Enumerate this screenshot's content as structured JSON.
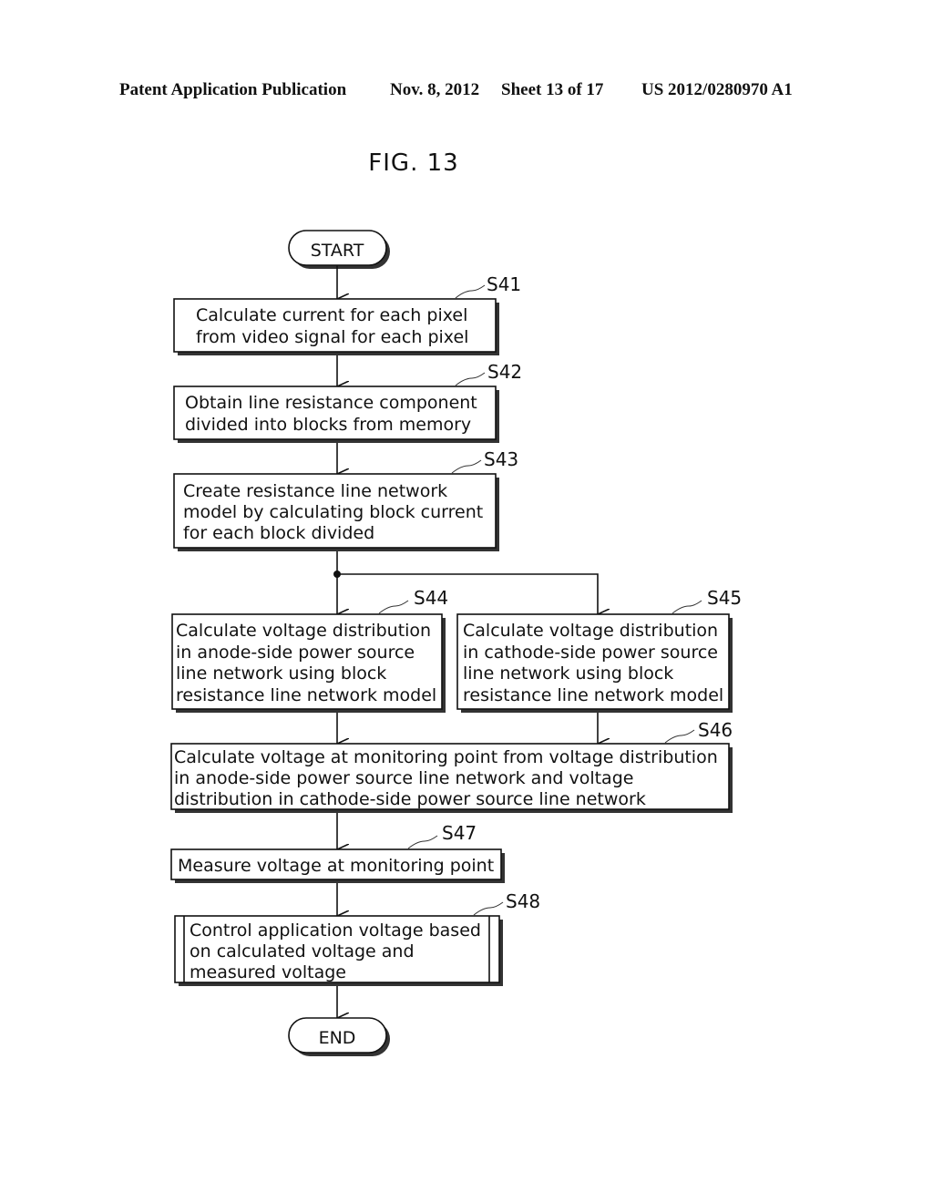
{
  "header": {
    "publication": "Patent Application Publication",
    "date": "Nov. 8, 2012",
    "sheet": "Sheet 13 of 17",
    "number": "US 2012/0280970 A1"
  },
  "figure": {
    "title": "FIG. 13",
    "start": "START",
    "end": "END",
    "steps": [
      {
        "id": "S41",
        "lines": [
          "Calculate current for each pixel",
          "from video signal for each pixel"
        ]
      },
      {
        "id": "S42",
        "lines": [
          "Obtain line resistance component",
          "divided into blocks from memory"
        ]
      },
      {
        "id": "S43",
        "lines": [
          "Create resistance line network",
          "model by calculating block current",
          "for each block divided"
        ]
      },
      {
        "id": "S44",
        "lines": [
          "Calculate voltage distribution",
          "in anode-side power source",
          "line network using block",
          "resistance line network model"
        ]
      },
      {
        "id": "S45",
        "lines": [
          "Calculate voltage distribution",
          "in cathode-side power source",
          "line network using block",
          "resistance line network model"
        ]
      },
      {
        "id": "S46",
        "lines": [
          "Calculate voltage at monitoring point from voltage distribution",
          "in anode-side power source line network and voltage",
          "distribution in cathode-side power source line network"
        ]
      },
      {
        "id": "S47",
        "lines": [
          "Measure voltage at monitoring point"
        ]
      },
      {
        "id": "S48",
        "lines": [
          "Control application voltage based",
          "on calculated voltage and",
          "measured voltage"
        ]
      }
    ]
  }
}
